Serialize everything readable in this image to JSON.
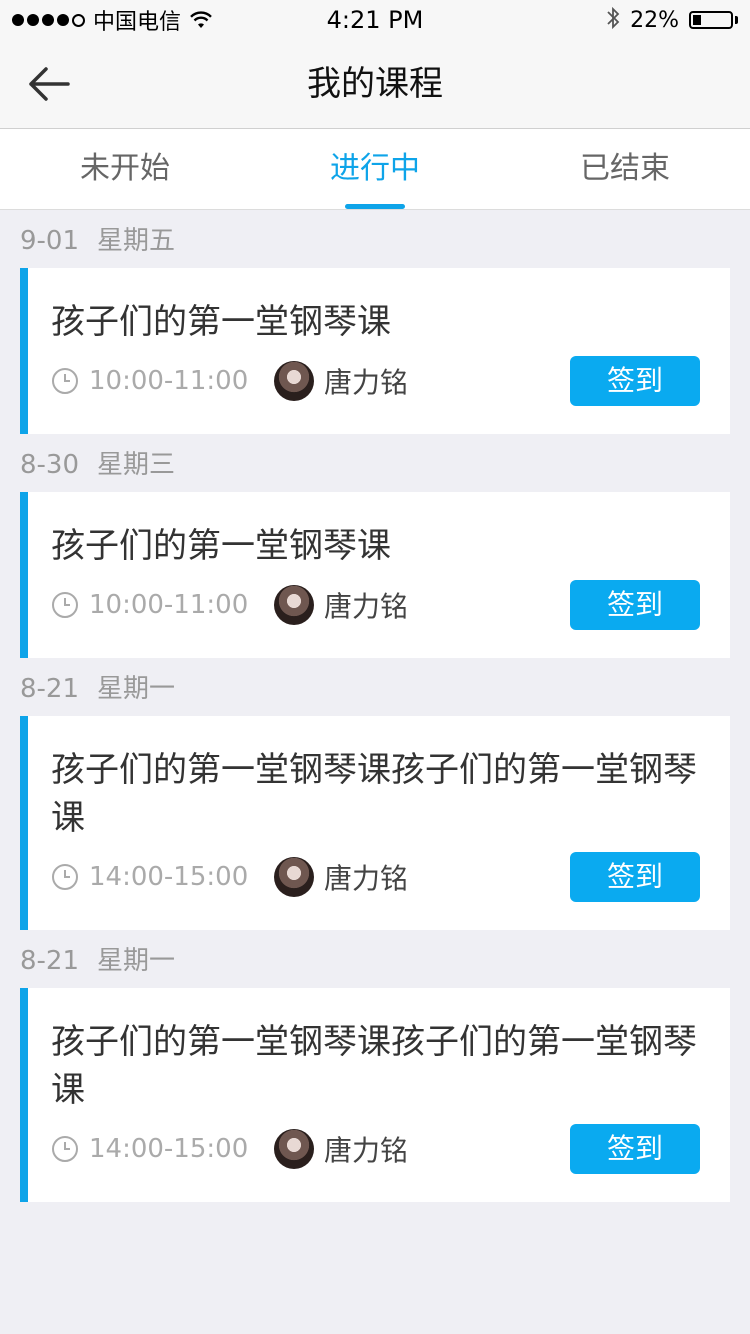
{
  "status_bar": {
    "carrier": "中国电信",
    "time": "4:21 PM",
    "battery_pct": "22%",
    "battery_level": 0.22
  },
  "nav": {
    "title": "我的课程"
  },
  "tabs": [
    {
      "label": "未开始",
      "active": false
    },
    {
      "label": "进行中",
      "active": true
    },
    {
      "label": "已结束",
      "active": false
    }
  ],
  "accent_color": "#0ea4e9",
  "groups": [
    {
      "date": "9-01",
      "weekday": "星期五",
      "course": {
        "title": "孩子们的第一堂钢琴课",
        "time": "10:00-11:00",
        "teacher": "唐力铭",
        "action": "签到"
      }
    },
    {
      "date": "8-30",
      "weekday": "星期三",
      "course": {
        "title": "孩子们的第一堂钢琴课",
        "time": "10:00-11:00",
        "teacher": "唐力铭",
        "action": "签到"
      }
    },
    {
      "date": "8-21",
      "weekday": "星期一",
      "course": {
        "title": "孩子们的第一堂钢琴课孩子们的第一堂钢琴课",
        "time": "14:00-15:00",
        "teacher": "唐力铭",
        "action": "签到"
      }
    },
    {
      "date": "8-21",
      "weekday": "星期一",
      "course": {
        "title": "孩子们的第一堂钢琴课孩子们的第一堂钢琴课",
        "time": "14:00-15:00",
        "teacher": "唐力铭",
        "action": "签到"
      }
    }
  ]
}
